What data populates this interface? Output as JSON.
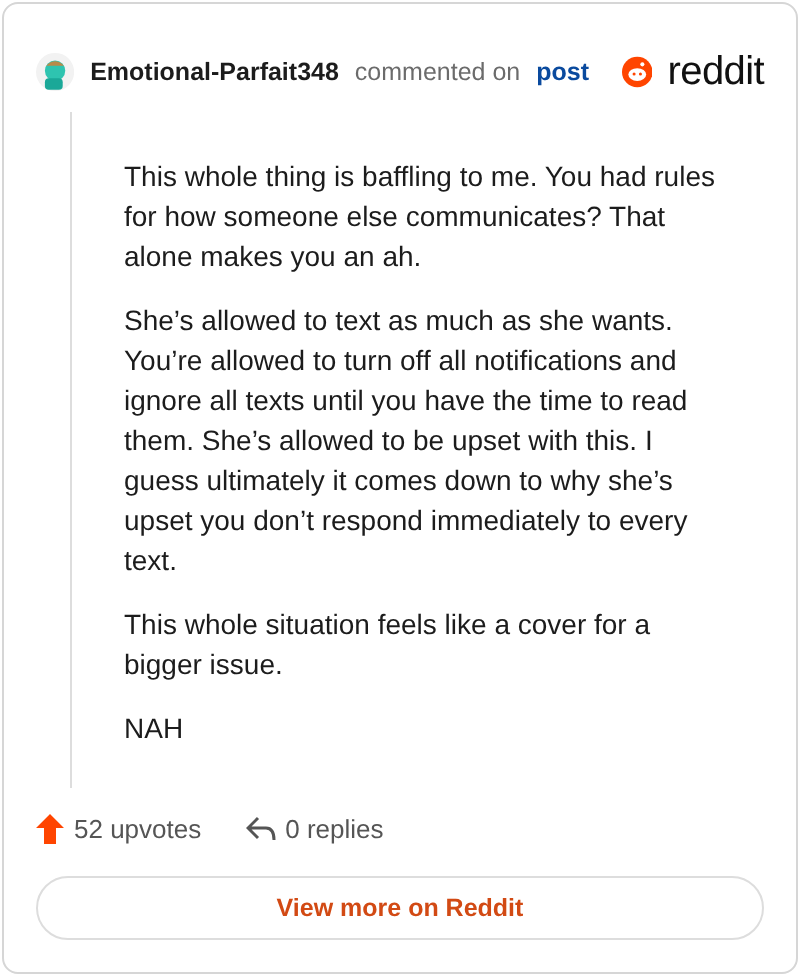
{
  "comment": {
    "author": "Emotional-Parfait348",
    "action": "commented on",
    "link": "post",
    "brand": "reddit",
    "paragraphs": [
      "This whole thing is baffling to me. You had rules for how someone else communicates? That alone makes you an ah.",
      "She’s allowed to text as much as she wants. You’re allowed to turn off all notifications and ignore all texts until you have the time to read them. She’s allowed to be upset with this. I guess ultimately it comes down to why she’s upset you don’t respond immediately to every text.",
      "This whole situation feels like a cover for a bigger issue.",
      "NAH"
    ],
    "upvotes": "52 upvotes",
    "replies": "0 replies"
  },
  "button": "View more on Reddit"
}
